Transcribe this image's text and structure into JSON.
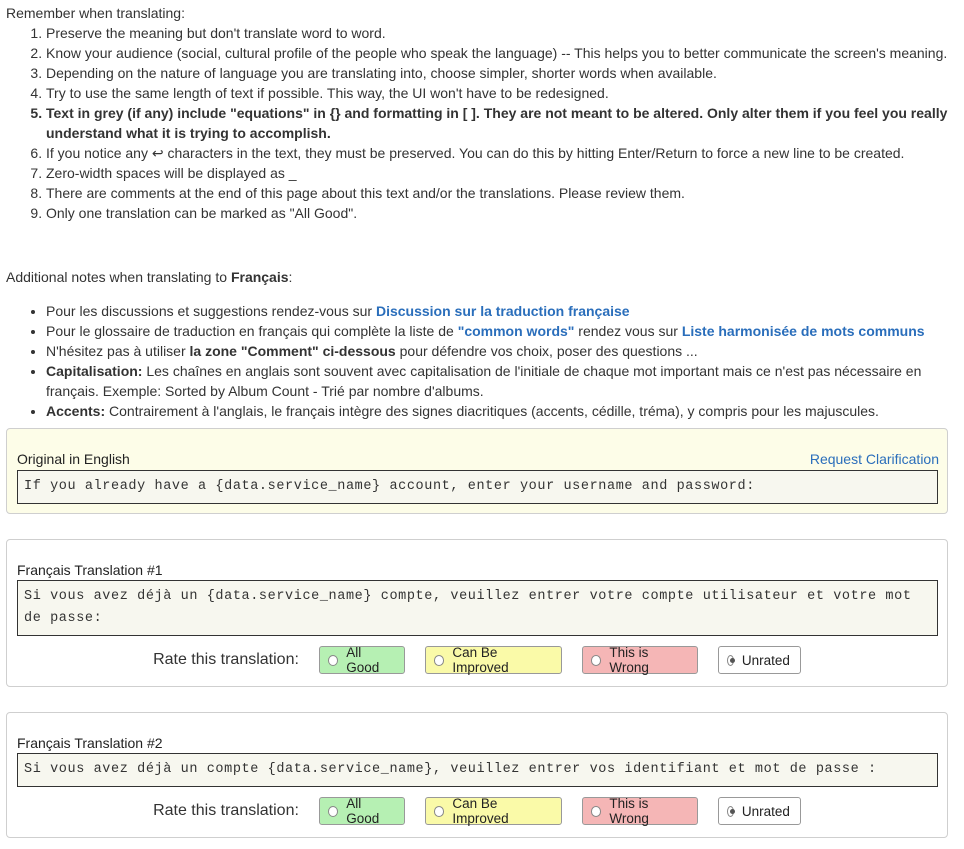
{
  "intro": {
    "heading": "Remember when translating:",
    "rules": [
      "Preserve the meaning but don't translate word to word.",
      "Know your audience (social, cultural profile of the people who speak the language) -- This helps you to better communicate the screen's meaning.",
      "Depending on the nature of language you are translating into, choose simpler, shorter words when available.",
      "Try to use the same length of text if possible. This way, the UI won't have to be redesigned.",
      "Text in grey (if any) include \"equations\" in {} and formatting in [ ]. They are not meant to be altered. Only alter them if you feel you really understand what it is trying to accomplish.",
      "If you notice any ↩ characters in the text, they must be preserved. You can do this by hitting Enter/Return to force a new line to be created.",
      "Zero-width spaces will be displayed as _",
      "There are comments at the end of this page about this text and/or the translations. Please review them.",
      "Only one translation can be marked as \"All Good\"."
    ]
  },
  "notes": {
    "heading_prefix": "Additional notes when translating to ",
    "heading_lang": "Français",
    "heading_suffix": ":",
    "n1_text": "Pour les discussions et suggestions rendez-vous sur ",
    "n1_link": "Discussion sur la traduction française",
    "n2_text_a": "Pour le glossaire de traduction en français qui complète la liste de ",
    "n2_link_a": "\"common words\"",
    "n2_text_b": " rendez vous sur ",
    "n2_link_b": "Liste harmonisée de mots communs",
    "n3_text_a": "N'hésitez pas à utiliser ",
    "n3_bold": "la zone \"Comment\" ci-dessous",
    "n3_text_b": " pour défendre vos choix, poser des questions ...",
    "n4_bold": "Capitalisation:",
    "n4_text": " Les chaînes en anglais sont souvent avec capitalisation de l'initiale de chaque mot important mais ce n'est pas nécessaire en français. Exemple: Sorted by Album Count - Trié par nombre d'albums.",
    "n5_bold": "Accents:",
    "n5_text": " Contrairement à l'anglais, le français intègre des signes diacritiques (accents, cédille, tréma), y compris pour les majuscules."
  },
  "original": {
    "label": "Original in English",
    "request": "Request Clarification",
    "text": "If you already have a {data.service_name} account, enter your username and password:"
  },
  "rating_labels": {
    "prompt": "Rate this translation:",
    "good": "All Good",
    "improve": "Can Be Improved",
    "wrong": "This is Wrong",
    "unrated": "Unrated"
  },
  "translations": [
    {
      "label": "Français Translation #1",
      "text": "Si vous avez déjà un {data.service_name} compte, veuillez entrer votre compte utilisateur et votre mot de passe:",
      "selected": "unrated"
    },
    {
      "label": "Français Translation #2",
      "text": "Si vous avez déjà un compte {data.service_name}, veuillez entrer vos identifiant et mot de passe :",
      "selected": "unrated"
    }
  ]
}
